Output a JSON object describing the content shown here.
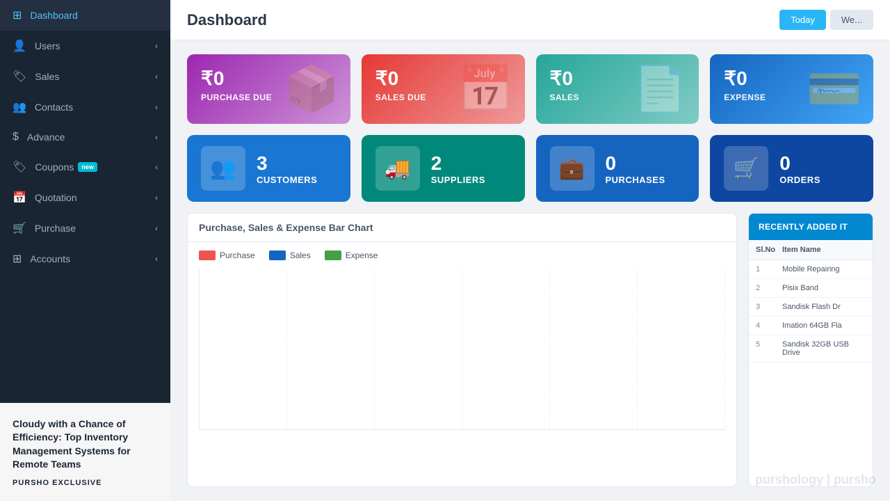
{
  "sidebar": {
    "items": [
      {
        "label": "Dashboard",
        "icon": "⊞",
        "active": true,
        "hasChevron": false
      },
      {
        "label": "Users",
        "icon": "👤",
        "active": false,
        "hasChevron": true
      },
      {
        "label": "Sales",
        "icon": "🏷",
        "active": false,
        "hasChevron": true
      },
      {
        "label": "Contacts",
        "icon": "👥",
        "active": false,
        "hasChevron": true
      },
      {
        "label": "Advance",
        "icon": "$",
        "active": false,
        "hasChevron": true
      },
      {
        "label": "Coupons",
        "icon": "🏷",
        "active": false,
        "hasChevron": true,
        "badge": "new"
      },
      {
        "label": "Quotation",
        "icon": "📅",
        "active": false,
        "hasChevron": true
      },
      {
        "label": "Purchase",
        "icon": "🛒",
        "active": false,
        "hasChevron": true
      },
      {
        "label": "Accounts",
        "icon": "⊞",
        "active": false,
        "hasChevron": true
      }
    ]
  },
  "header": {
    "title": "Dashboard",
    "btn_today": "Today",
    "btn_week": "We..."
  },
  "stat_cards": [
    {
      "amount": "₹0",
      "label": "PURCHASE DUE",
      "icon": "📦",
      "color_class": "card-purple"
    },
    {
      "amount": "₹0",
      "label": "SALES DUE",
      "icon": "📅",
      "color_class": "card-red"
    },
    {
      "amount": "₹0",
      "label": "SALES",
      "icon": "📄",
      "color_class": "card-teal"
    },
    {
      "amount": "₹0",
      "label": "EXPENSE",
      "icon": "💳",
      "color_class": "card-dark-blue"
    }
  ],
  "info_cards": [
    {
      "count": "3",
      "label": "CUSTOMERS",
      "icon": "👥",
      "color_class": "info-card-blue"
    },
    {
      "count": "2",
      "label": "SUPPLIERS",
      "icon": "🚚",
      "color_class": "info-card-teal"
    },
    {
      "count": "0",
      "label": "PURCHASES",
      "icon": "💼",
      "color_class": "info-card-dark"
    },
    {
      "count": "0",
      "label": "ORDERS",
      "icon": "🛒",
      "color_class": "info-card-dark"
    }
  ],
  "chart": {
    "title": "Purchase, Sales & Expense Bar Chart",
    "legend": [
      {
        "label": "Purchase",
        "color": "dot-red"
      },
      {
        "label": "Sales",
        "color": "dot-blue"
      },
      {
        "label": "Expense",
        "color": "dot-green"
      }
    ]
  },
  "recently": {
    "header": "RECENTLY ADDED IT",
    "col_sl": "Sl.No",
    "col_name": "Item Name",
    "items": [
      {
        "sl": "1",
        "name": "Mobile Repairing"
      },
      {
        "sl": "2",
        "name": "Pisix Band"
      },
      {
        "sl": "3",
        "name": "Sandisk Flash Dr"
      },
      {
        "sl": "4",
        "name": "Imation 64GB Fla"
      },
      {
        "sl": "5",
        "name": "Sandisk 32GB USB Drive"
      }
    ]
  },
  "ad": {
    "title": "Cloudy with a Chance of Efficiency: Top Inventory Management Systems for Remote Teams",
    "label": "PURSHO EXCLUSIVE"
  },
  "brand": "purshology | pursho"
}
